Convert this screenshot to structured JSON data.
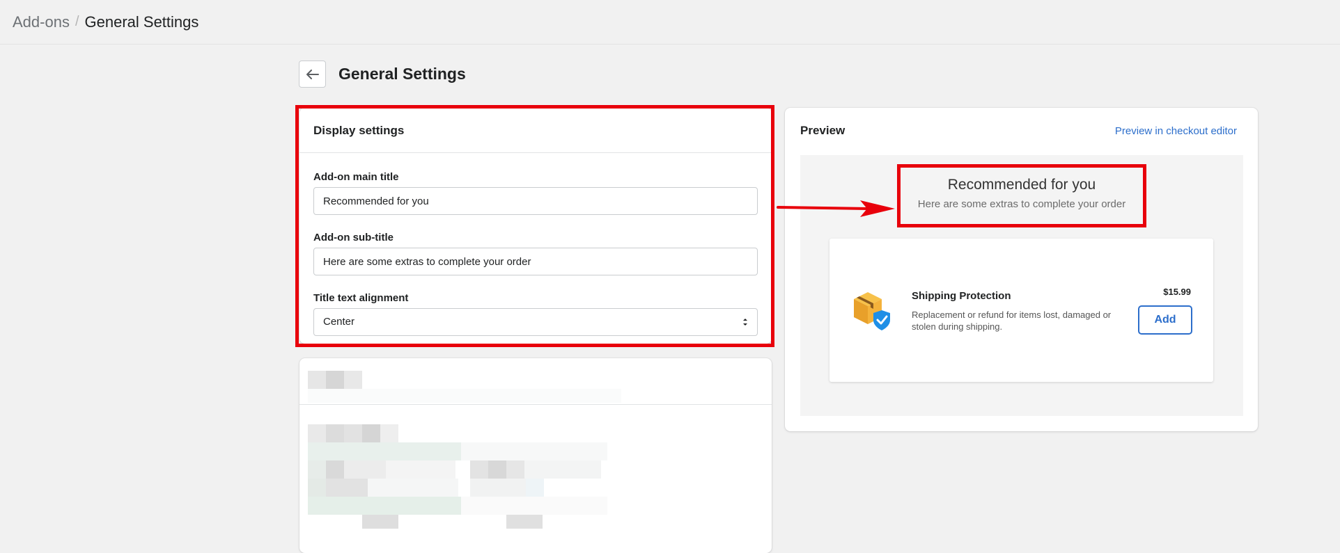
{
  "breadcrumb": {
    "parent": "Add-ons",
    "separator": "/",
    "current": "General Settings"
  },
  "page": {
    "title": "General Settings",
    "back_icon": "arrow-left-icon"
  },
  "display_settings": {
    "heading": "Display settings",
    "main_title": {
      "label": "Add-on main title",
      "value": "Recommended for you"
    },
    "sub_title": {
      "label": "Add-on sub-title",
      "value": "Here are some extras to complete your order"
    },
    "alignment": {
      "label": "Title text alignment",
      "value": "Center"
    }
  },
  "preview": {
    "heading": "Preview",
    "editor_link": "Preview in checkout editor",
    "title": "Recommended for you",
    "subtitle": "Here are some extras to complete your order",
    "product": {
      "icon": "package-shield-icon",
      "name": "Shipping Protection",
      "description": "Replacement or refund for items lost, damaged or stolen during shipping.",
      "price": "$15.99",
      "add_label": "Add"
    }
  },
  "colors": {
    "annotation_red": "#e8000b",
    "link_blue": "#2c6ecb"
  }
}
